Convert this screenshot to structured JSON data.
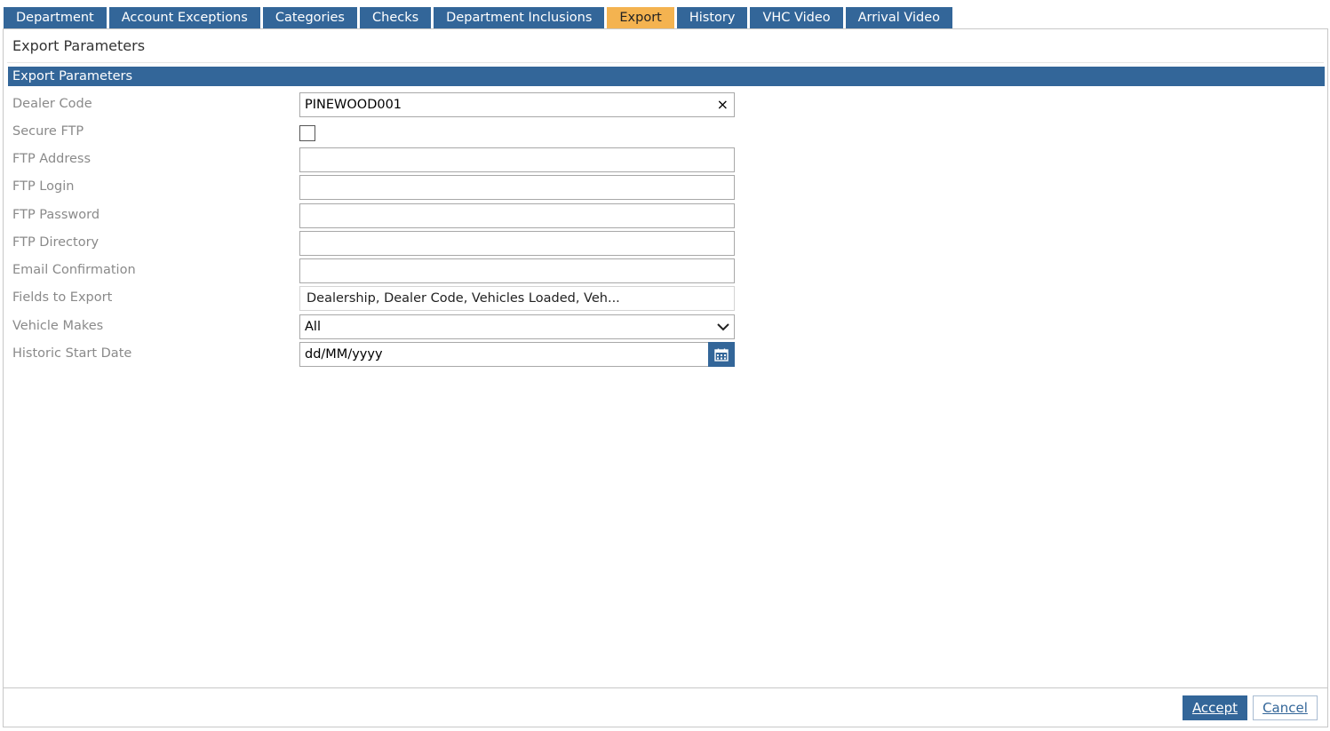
{
  "tabs": [
    {
      "label": "Department"
    },
    {
      "label": "Account Exceptions"
    },
    {
      "label": "Categories"
    },
    {
      "label": "Checks"
    },
    {
      "label": "Department Inclusions"
    },
    {
      "label": "Export",
      "active": true
    },
    {
      "label": "History"
    },
    {
      "label": "VHC Video"
    },
    {
      "label": "Arrival Video"
    }
  ],
  "panel": {
    "title": "Export Parameters",
    "section_header": "Export Parameters"
  },
  "form": {
    "dealer_code": {
      "label": "Dealer Code",
      "value": "PINEWOOD001",
      "clear_icon": "×"
    },
    "secure_ftp": {
      "label": "Secure FTP",
      "checked": false
    },
    "ftp_address": {
      "label": "FTP Address",
      "value": ""
    },
    "ftp_login": {
      "label": "FTP Login",
      "value": ""
    },
    "ftp_password": {
      "label": "FTP Password",
      "value": ""
    },
    "ftp_directory": {
      "label": "FTP Directory",
      "value": ""
    },
    "email_confirmation": {
      "label": "Email Confirmation",
      "value": ""
    },
    "fields_to_export": {
      "label": "Fields to Export",
      "value": "Dealership, Dealer Code, Vehicles Loaded, Veh..."
    },
    "vehicle_makes": {
      "label": "Vehicle Makes",
      "value": "All",
      "icon": "chevron-down-icon"
    },
    "historic_start_date": {
      "label": "Historic Start Date",
      "value": "dd/MM/yyyy",
      "icon": "calendar-icon"
    }
  },
  "footer": {
    "accept_label": "Accept",
    "cancel_label": "Cancel"
  },
  "colors": {
    "tab_bg": "#336699",
    "tab_active_bg": "#f4b350",
    "header_bg": "#336699",
    "label_text": "#8a8a8a"
  }
}
